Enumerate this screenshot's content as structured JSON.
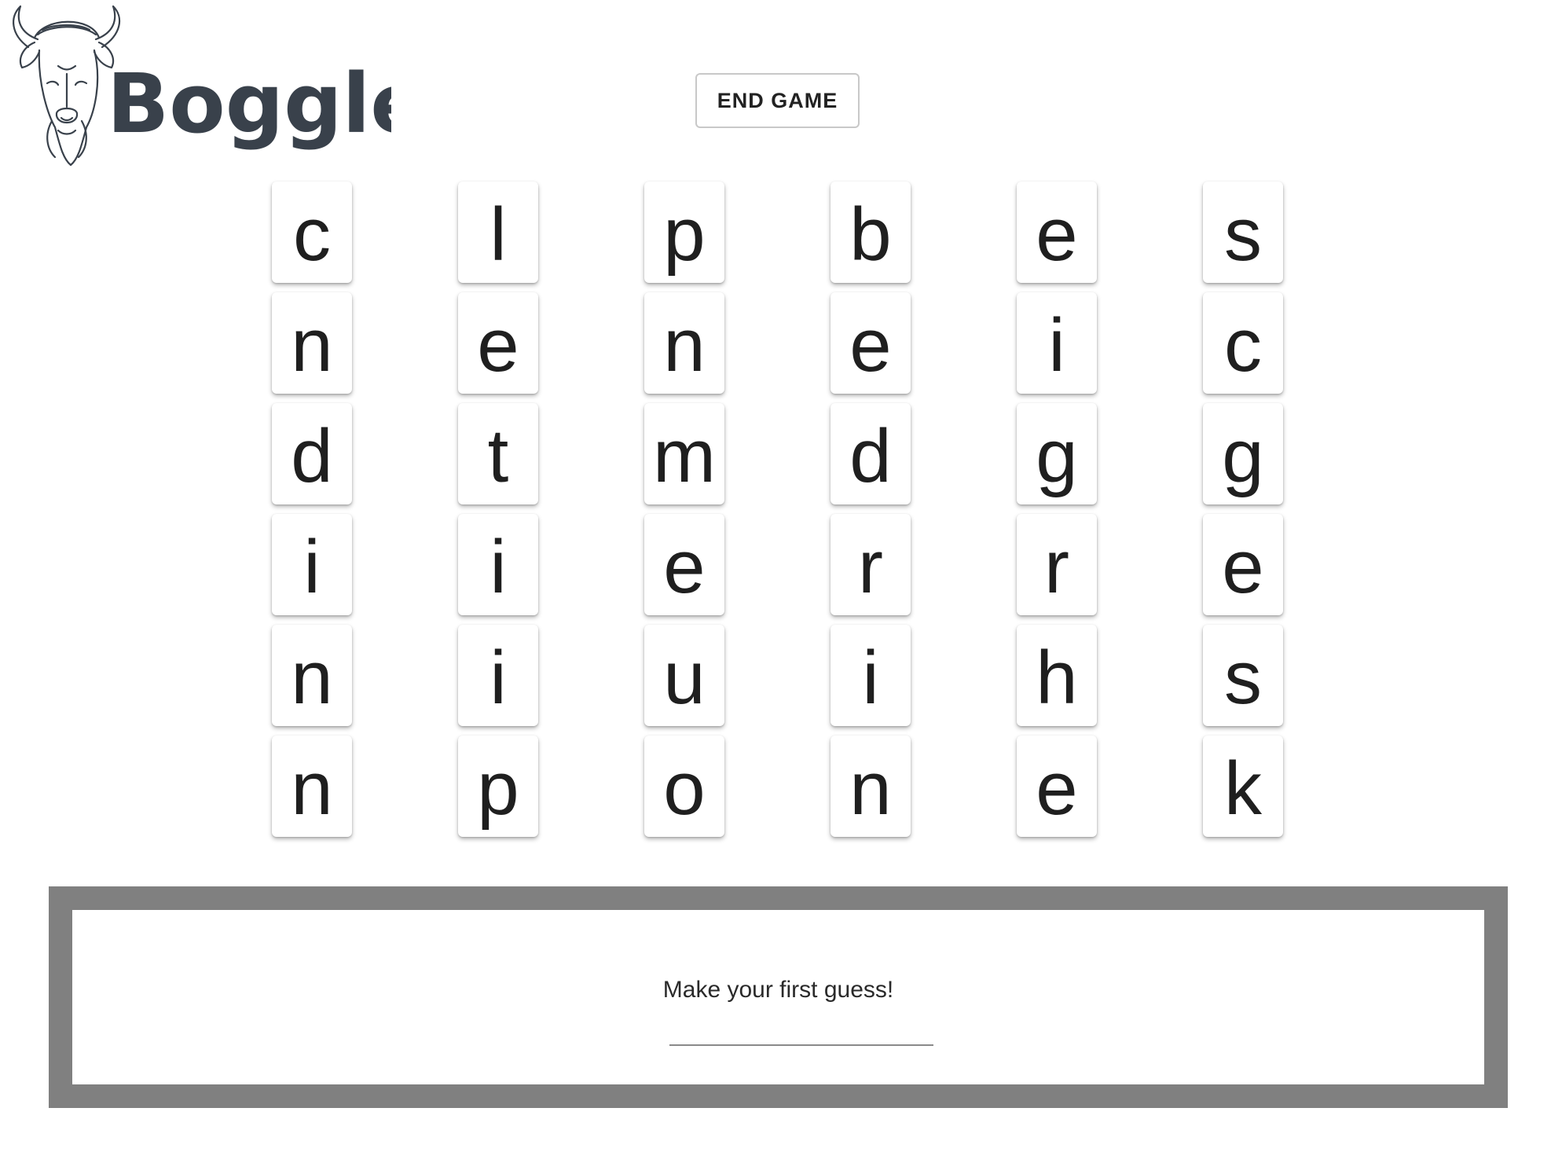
{
  "logo": {
    "text": "Boggle",
    "icon": "bison-head-icon"
  },
  "controls": {
    "end_game_label": "END GAME"
  },
  "board": {
    "columns": [
      [
        "c",
        "n",
        "d",
        "i",
        "n",
        "n"
      ],
      [
        "l",
        "e",
        "t",
        "i",
        "i",
        "p"
      ],
      [
        "p",
        "n",
        "m",
        "e",
        "u",
        "o"
      ],
      [
        "b",
        "e",
        "d",
        "r",
        "i",
        "n"
      ],
      [
        "e",
        "i",
        "g",
        "r",
        "h",
        "e"
      ],
      [
        "s",
        "c",
        "g",
        "e",
        "s",
        "k"
      ]
    ]
  },
  "guess": {
    "prompt": "Make your first guess!",
    "value": "",
    "placeholder": ""
  },
  "colors": {
    "panel_border": "#808080",
    "logo": "#39414b",
    "tile_text": "#1f1f1f"
  }
}
